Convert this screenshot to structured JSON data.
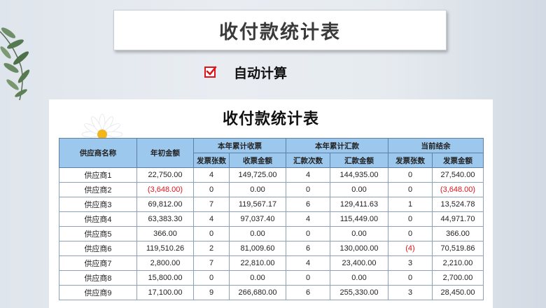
{
  "header": {
    "title": "收付款统计表"
  },
  "auto_calc": {
    "label": "自动计算",
    "checked": true
  },
  "sheet": {
    "title": "收付款统计表"
  },
  "table": {
    "col_supplier": "供应商名称",
    "col_opening": "年初金额",
    "group_receipts": "本年累计收票",
    "group_payments": "本年累计汇款",
    "group_balance": "当前结余",
    "sub_invoice_count": "发票张数",
    "sub_invoice_amount": "收票金额",
    "sub_payment_count": "汇款次数",
    "sub_payment_amount": "汇款金额",
    "sub_bal_invoice_count": "发票张数",
    "sub_bal_invoice_amount": "发票金额",
    "rows": [
      {
        "name": "供应商1",
        "opening": "22,750.00",
        "inv_count": "4",
        "inv_amount": "149,725.00",
        "pay_count": "4",
        "pay_amount": "144,935.00",
        "bal_count": "0",
        "bal_amount": "27,540.00"
      },
      {
        "name": "供应商2",
        "opening": "(3,648.00)",
        "inv_count": "0",
        "inv_amount": "0.00",
        "pay_count": "0",
        "pay_amount": "0.00",
        "bal_count": "0",
        "bal_amount": "(3,648.00)"
      },
      {
        "name": "供应商3",
        "opening": "69,812.00",
        "inv_count": "7",
        "inv_amount": "119,567.17",
        "pay_count": "6",
        "pay_amount": "129,411.63",
        "bal_count": "1",
        "bal_amount": "13,524.78"
      },
      {
        "name": "供应商4",
        "opening": "63,383.30",
        "inv_count": "4",
        "inv_amount": "97,037.40",
        "pay_count": "4",
        "pay_amount": "115,449.00",
        "bal_count": "0",
        "bal_amount": "44,971.70"
      },
      {
        "name": "供应商5",
        "opening": "366.00",
        "inv_count": "0",
        "inv_amount": "0.00",
        "pay_count": "0",
        "pay_amount": "0.00",
        "bal_count": "0",
        "bal_amount": "366.00"
      },
      {
        "name": "供应商6",
        "opening": "119,510.26",
        "inv_count": "2",
        "inv_amount": "81,009.60",
        "pay_count": "6",
        "pay_amount": "130,000.00",
        "bal_count": "(4)",
        "bal_amount": "70,519.86"
      },
      {
        "name": "供应商7",
        "opening": "2,800.00",
        "inv_count": "7",
        "inv_amount": "22,810.00",
        "pay_count": "4",
        "pay_amount": "23,400.00",
        "bal_count": "3",
        "bal_amount": "2,210.00"
      },
      {
        "name": "供应商8",
        "opening": "15,800.00",
        "inv_count": "0",
        "inv_amount": "0.00",
        "pay_count": "0",
        "pay_amount": "0.00",
        "bal_count": "0",
        "bal_amount": "2,700.00"
      },
      {
        "name": "供应商9",
        "opening": "17,100.00",
        "inv_count": "9",
        "inv_amount": "266,680.00",
        "pay_count": "6",
        "pay_amount": "255,330.00",
        "bal_count": "3",
        "bal_amount": "28,450.00"
      }
    ]
  },
  "colors": {
    "negative": "#e0141c",
    "header_bg": "#9cc8ee",
    "checkbox": "#e0141c"
  },
  "icons": {
    "checkbox": "checkmark-icon",
    "plant": "plant-leaves-icon",
    "flower": "daisy-flower-icon"
  }
}
